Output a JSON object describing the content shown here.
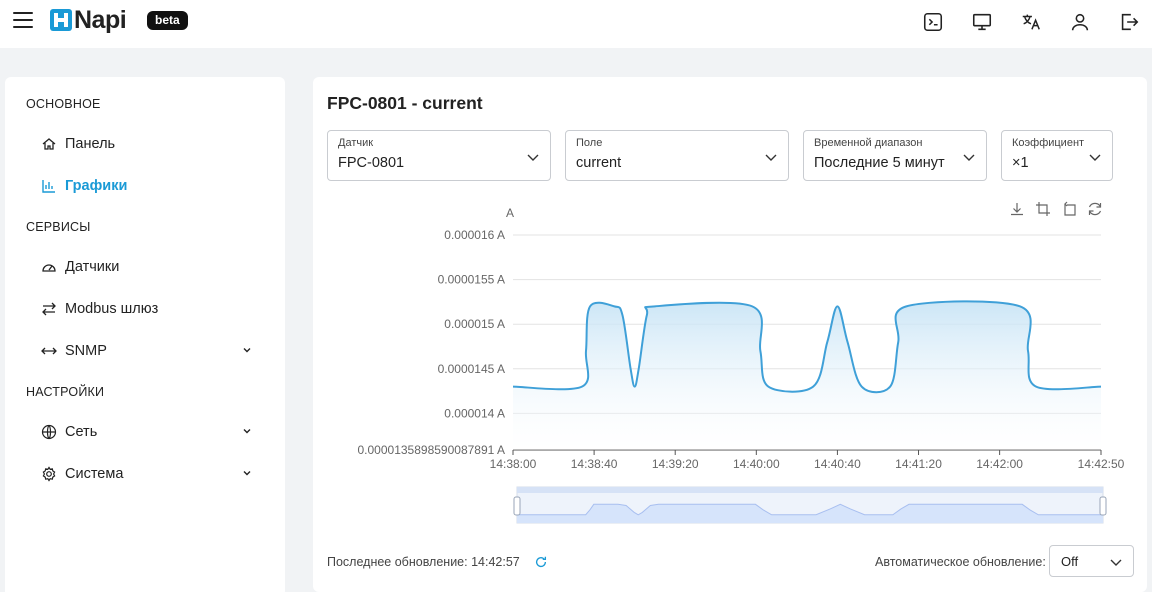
{
  "header": {
    "brand": "Napi",
    "badge": "beta",
    "icons": [
      "terminal-icon",
      "monitor-icon",
      "translate-icon",
      "user-icon",
      "logout-icon"
    ]
  },
  "sidebar": {
    "sections": [
      {
        "title": "ОСНОВНОЕ",
        "items": [
          {
            "label": "Панель",
            "icon": "home-icon"
          },
          {
            "label": "Графики",
            "icon": "bar-chart-icon",
            "active": true
          }
        ]
      },
      {
        "title": "СЕРВИСЫ",
        "items": [
          {
            "label": "Датчики",
            "icon": "gauge-icon"
          },
          {
            "label": "Modbus шлюз",
            "icon": "arrows-exchange-icon"
          },
          {
            "label": "SNMP",
            "icon": "arrows-horizontal-icon",
            "expandable": true
          }
        ]
      },
      {
        "title": "НАСТРОЙКИ",
        "items": [
          {
            "label": "Сеть",
            "icon": "globe-icon",
            "expandable": true
          },
          {
            "label": "Система",
            "icon": "gear-icon",
            "expandable": true
          }
        ]
      }
    ]
  },
  "main": {
    "title": "FPC-0801 - current",
    "filters": {
      "sensor": {
        "label": "Датчик",
        "value": "FPC-0801"
      },
      "field": {
        "label": "Поле",
        "value": "current"
      },
      "range": {
        "label": "Временной диапазон",
        "value": "Последние 5 минут"
      },
      "coef": {
        "label": "Коэффициент",
        "value": "×1"
      }
    },
    "footer": {
      "last_update": "Последнее обновление: 14:42:57",
      "auto_update_label": "Автоматическое обновление:",
      "auto_update_value": "Off"
    }
  },
  "colors": {
    "accent": "#1a9ad6",
    "line": "#3fa0d8",
    "area_top": "#c6e3f5",
    "zoom_fill": "#d6e4fb"
  },
  "chart_data": {
    "type": "area",
    "ylabel": "A",
    "ylim": [
      1.35898590087891e-05,
      1.62e-05
    ],
    "yticks": [
      {
        "value": 1.6e-05,
        "label": "0.000016 A"
      },
      {
        "value": 1.55e-05,
        "label": "0.0000155 A"
      },
      {
        "value": 1.5e-05,
        "label": "0.000015 A"
      },
      {
        "value": 1.45e-05,
        "label": "0.0000145 A"
      },
      {
        "value": 1.4e-05,
        "label": "0.000014 A"
      },
      {
        "value": 1.35898590087891e-05,
        "label": "0.0000135898590087891 A"
      }
    ],
    "xlim": [
      "14:38:00",
      "14:42:50"
    ],
    "xticks": [
      "14:38:00",
      "14:38:40",
      "14:39:20",
      "14:40:00",
      "14:40:40",
      "14:41:20",
      "14:42:00",
      "14:42:50"
    ],
    "grid": true,
    "series": [
      {
        "x": [
          "14:38:00",
          "14:38:34",
          "14:38:36",
          "14:38:38",
          "14:38:50",
          "14:38:54",
          "14:38:58",
          "14:39:00",
          "14:39:02",
          "14:39:06",
          "14:39:10",
          "14:39:58",
          "14:40:02",
          "14:40:06",
          "14:40:28",
          "14:40:35",
          "14:40:40",
          "14:40:45",
          "14:40:52",
          "14:41:06",
          "14:41:10",
          "14:41:14",
          "14:42:10",
          "14:42:14",
          "14:42:18",
          "14:42:50"
        ],
        "y": [
          1.43e-05,
          1.43e-05,
          1.47e-05,
          1.52e-05,
          1.52e-05,
          1.51e-05,
          1.45e-05,
          1.43e-05,
          1.45e-05,
          1.51e-05,
          1.52e-05,
          1.52e-05,
          1.47e-05,
          1.43e-05,
          1.43e-05,
          1.48e-05,
          1.52e-05,
          1.48e-05,
          1.43e-05,
          1.43e-05,
          1.48e-05,
          1.52e-05,
          1.52e-05,
          1.47e-05,
          1.43e-05,
          1.43e-05
        ]
      }
    ]
  }
}
